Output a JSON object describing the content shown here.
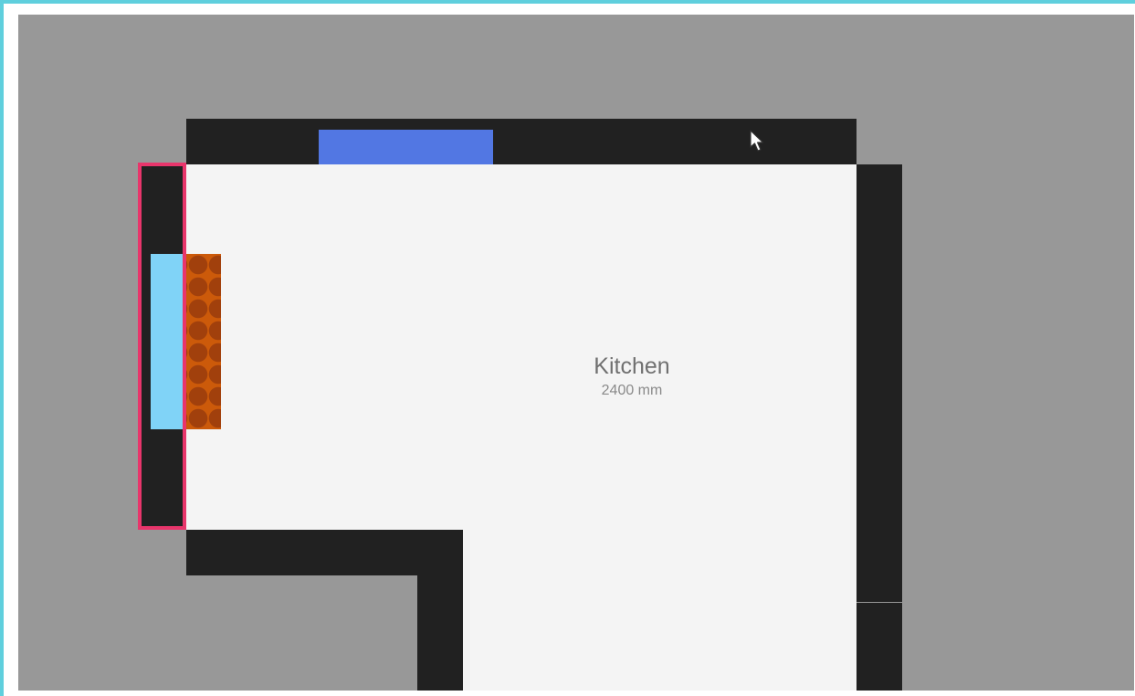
{
  "room": {
    "name": "Kitchen",
    "size": "2400 mm"
  },
  "colors": {
    "frame_border": "#5fcfdd",
    "canvas_background": "#989898",
    "wall": "#212121",
    "floor": "#f4f4f4",
    "top_window": "#5277e3",
    "left_window": "#80d3f7",
    "radiator": "#cc5a0a",
    "selection": "#e8356b"
  },
  "icons": {
    "cursor": "mouse-pointer-icon"
  }
}
